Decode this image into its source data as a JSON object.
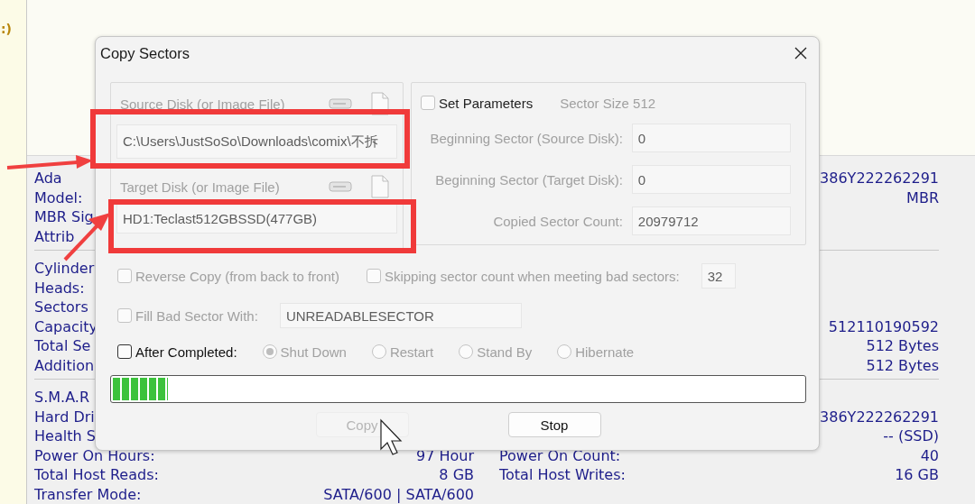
{
  "background_window": {
    "corner_text": ":)",
    "sections": [
      {
        "rows": [
          {
            "label": "Ada",
            "value": "386Y222262291"
          },
          {
            "label": "Model:",
            "value": "MBR"
          },
          {
            "label": "MBR Sig"
          },
          {
            "label": "Attrib"
          }
        ]
      },
      {
        "rows": [
          {
            "label": "Cylinder"
          },
          {
            "label": "Heads:"
          },
          {
            "label": "Sectors"
          },
          {
            "label": "Capacity",
            "value": "512110190592"
          },
          {
            "label": "Total Se",
            "value": "512 Bytes"
          },
          {
            "label": "Addition",
            "value": "512 Bytes"
          }
        ]
      },
      {
        "rows": [
          {
            "label": "S.M.A.R"
          },
          {
            "label": "Hard Dri",
            "value": "386Y222262291"
          },
          {
            "label": "Health S",
            "value": "-- (SSD)"
          },
          {
            "label": "Power On Hours:",
            "left_value": "97 Hour",
            "right_label": "Power On Count:",
            "value": "40"
          },
          {
            "label": "Total Host Reads:",
            "left_value": "8 GB",
            "right_label": "Total Host Writes:",
            "value": "16 GB"
          },
          {
            "label": "Transfer Mode:",
            "left_value": "SATA/600 | SATA/600"
          }
        ]
      }
    ]
  },
  "dialog": {
    "title": "Copy Sectors",
    "disk_group": {
      "disabled": true,
      "source": {
        "label": "Source Disk (or Image File)",
        "value": "C:\\Users\\JustSoSo\\Downloads\\comix\\不拆"
      },
      "target": {
        "label": "Target Disk (or Image File)",
        "value": "HD1:Teclast512GBSSD(477GB)"
      }
    },
    "parameters": {
      "label": "Set Parameters",
      "checked": false,
      "sector_size": "Sector Size 512",
      "fields": [
        {
          "label": "Beginning Sector (Source Disk):",
          "value": "0"
        },
        {
          "label": "Beginning Sector (Target Disk):",
          "value": "0"
        },
        {
          "label": "Copied Sector Count:",
          "value": "20979712"
        }
      ]
    },
    "option_rows": [
      [
        {
          "label": "Reverse Copy (from back to front)",
          "checked": false,
          "disabled": true
        },
        {
          "label": "Skipping sector count when meeting bad sectors:",
          "checked": false,
          "disabled": true,
          "value": "32"
        }
      ],
      [
        {
          "label": "Fill Bad Sector With:",
          "checked": false,
          "disabled": true,
          "value": "UNREADABLESECTOR"
        }
      ]
    ],
    "after_completed": {
      "label": "After Completed:",
      "checked": false,
      "disabled": false,
      "choices": [
        {
          "label": "Shut Down",
          "selected": true,
          "disabled": true
        },
        {
          "label": "Restart",
          "selected": false,
          "disabled": true
        },
        {
          "label": "Stand By",
          "selected": false,
          "disabled": true
        },
        {
          "label": "Hibernate",
          "selected": false,
          "disabled": true
        }
      ]
    },
    "progress": {
      "level": 0.08
    },
    "buttons": [
      {
        "label": "Copy",
        "disabled": true
      },
      {
        "label": "Stop",
        "disabled": false
      }
    ]
  }
}
